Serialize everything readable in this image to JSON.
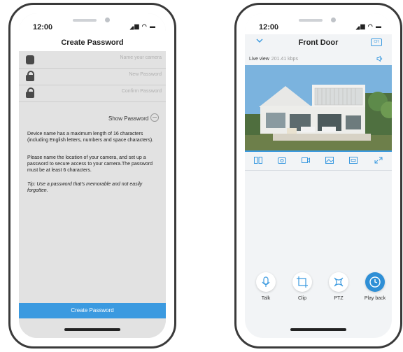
{
  "left_phone": {
    "status_time": "12:00",
    "title": "Create Password",
    "fields": [
      {
        "placeholder": "Name your camera"
      },
      {
        "placeholder": "New Password"
      },
      {
        "placeholder": "Confirm Password"
      }
    ],
    "show_password_label": "Show Password",
    "info_1": "Device name has a maximum length of 16 characters (including English letters, numbers and space characters).",
    "info_2": "Please name the location of your camera, and set up a password to secure access to your camera.The password must be at least 6 characters.",
    "tip": "Tip: Use a password that's memorable and not easily forgotten.",
    "create_button": "Create Password"
  },
  "right_phone": {
    "status_time": "12:00",
    "title": "Front Door",
    "ch_badge": "CH",
    "live_label": "Live view",
    "bitrate": "201.41 kbps",
    "controls": [
      "split-view-icon",
      "snapshot-icon",
      "record-icon",
      "image-icon",
      "hd-icon",
      "fullscreen-icon"
    ],
    "actions": [
      {
        "label": "Talk"
      },
      {
        "label": "Clip"
      },
      {
        "label": "PTZ"
      },
      {
        "label": "Play back"
      }
    ]
  },
  "colors": {
    "accent": "#3b9ae0",
    "playback": "#2f8fd6",
    "sky": "#6aa7d6"
  }
}
